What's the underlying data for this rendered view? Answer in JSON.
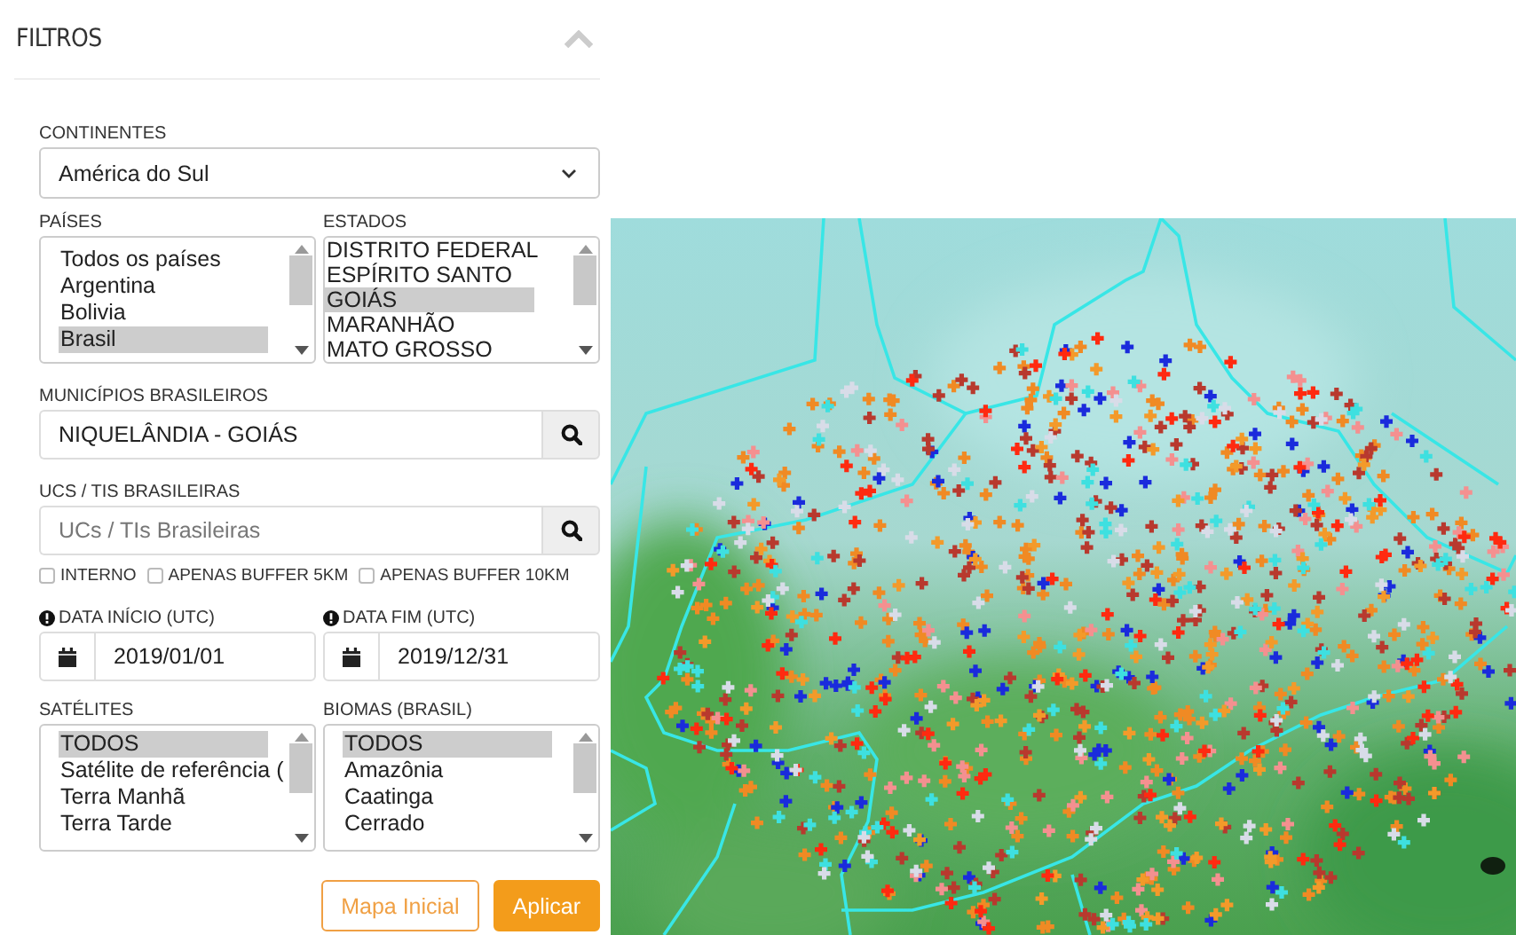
{
  "filters": {
    "title": "FILTROS",
    "continents": {
      "label": "CONTINENTES",
      "value": "América do Sul"
    },
    "countries": {
      "label": "PAÍSES",
      "items": [
        {
          "text": "Todos os países",
          "selected": false
        },
        {
          "text": "Argentina",
          "selected": false
        },
        {
          "text": "Bolivia",
          "selected": false
        },
        {
          "text": "Brasil",
          "selected": true
        }
      ]
    },
    "states": {
      "label": "ESTADOS",
      "items": [
        {
          "text": "DISTRITO FEDERAL",
          "selected": false
        },
        {
          "text": "ESPÍRITO SANTO",
          "selected": false
        },
        {
          "text": "GOIÁS",
          "selected": true
        },
        {
          "text": "MARANHÃO",
          "selected": false
        },
        {
          "text": "MATO GROSSO",
          "selected": false
        }
      ]
    },
    "municipalities": {
      "label": "MUNICÍPIOS BRASILEIROS",
      "value": "NIQUELÂNDIA - GOIÁS"
    },
    "protected_areas": {
      "label": "UCS / TIS BRASILEIRAS",
      "placeholder": "UCs / TIs Brasileiras"
    },
    "options": [
      {
        "label": "INTERNO",
        "checked": false
      },
      {
        "label": "APENAS BUFFER 5KM",
        "checked": false
      },
      {
        "label": "APENAS BUFFER 10KM",
        "checked": false
      }
    ],
    "start_date": {
      "label": "DATA INÍCIO (UTC)",
      "value": "2019/01/01"
    },
    "end_date": {
      "label": "DATA FIM (UTC)",
      "value": "2019/12/31"
    },
    "satellites": {
      "label": "SATÉLITES",
      "items": [
        {
          "text": "TODOS",
          "selected": true
        },
        {
          "text": "Satélite de referência (",
          "selected": false
        },
        {
          "text": "Terra Manhã",
          "selected": false
        },
        {
          "text": "Terra Tarde",
          "selected": false
        }
      ]
    },
    "biomes": {
      "label": "BIOMAS (BRASIL)",
      "items": [
        {
          "text": "TODOS",
          "selected": true
        },
        {
          "text": "Amazônia",
          "selected": false
        },
        {
          "text": "Caatinga",
          "selected": false
        },
        {
          "text": "Cerrado",
          "selected": false
        }
      ]
    },
    "buttons": [
      {
        "label": "Mapa Inicial",
        "kind": "outline"
      },
      {
        "label": "Aplicar",
        "kind": "primary"
      }
    ]
  }
}
